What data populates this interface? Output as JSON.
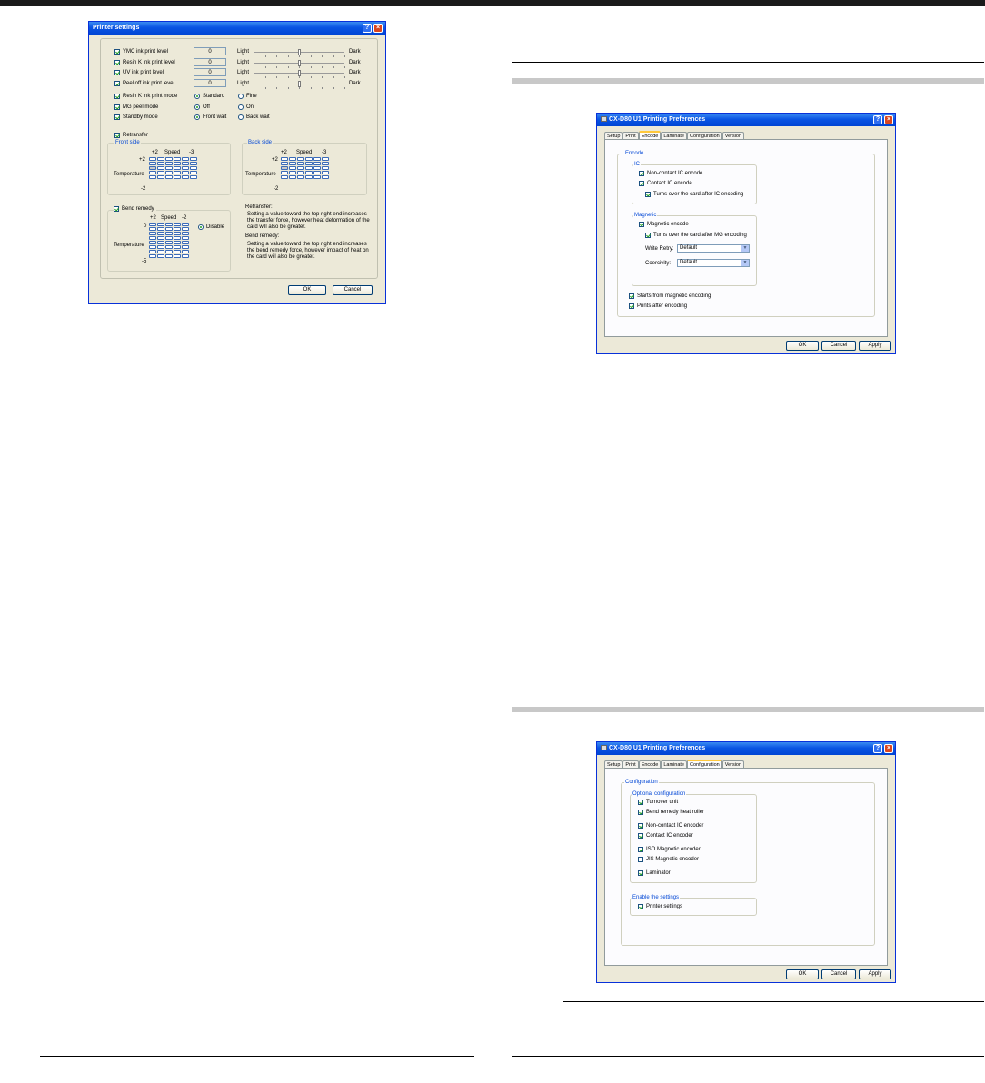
{
  "printer_settings": {
    "title": "Printer settings",
    "levels": [
      {
        "label": "YMC ink print level",
        "value": "0",
        "light": "Light",
        "dark": "Dark",
        "level_pct": 50
      },
      {
        "label": "Resin K ink print level",
        "value": "0",
        "light": "Light",
        "dark": "Dark",
        "level_pct": 50
      },
      {
        "label": "UV ink print level",
        "value": "0",
        "light": "Light",
        "dark": "Dark",
        "level_pct": 50
      },
      {
        "label": "Peel off ink print level",
        "value": "0",
        "light": "Light",
        "dark": "Dark",
        "level_pct": 50
      }
    ],
    "modes": [
      {
        "label": "Resin K ink print mode",
        "opt1": "Standard",
        "opt2": "Fine",
        "selected": 1
      },
      {
        "label": "MG peel mode",
        "opt1": "Off",
        "opt2": "On",
        "selected": 1
      },
      {
        "label": "Standby mode",
        "opt1": "Front wait",
        "opt2": "Back wait",
        "selected": 1
      }
    ],
    "retransfer": "Retransfer",
    "front_side": "Front side",
    "back_side": "Back side",
    "speed": "Speed",
    "temperature": "Temperature",
    "plus2": "+2",
    "minus3": "-3",
    "minus2": "-2",
    "bend_remedy": "Bend remedy",
    "bend_plus2": "+2",
    "bend_minus2": "-2",
    "bend_zero": "0",
    "bend_minus5": "-5",
    "disable": "Disable",
    "retransfer_note_title": "Retransfer:",
    "retransfer_note": "Setting a value toward the top right end increases the transfer force, however heat deformation of the card will also be greater.",
    "bend_note_title": "Bend remedy:",
    "bend_note": "Setting a value toward the top right end increases the bend remedy force, however impact of heat on the card will also be greater.",
    "ok": "OK",
    "cancel": "Cancel"
  },
  "encode_dialog": {
    "title": "CX-D80 U1 Printing Preferences",
    "tabs": [
      "Setup",
      "Print",
      "Encode",
      "Laminate",
      "Configuration",
      "Version"
    ],
    "active_tab": "Encode",
    "encode_group": "Encode",
    "ic_group": "IC",
    "non_contact_ic": "Non-contact IC encode",
    "contact_ic": "Contact IC encode",
    "turn_over_ic": "Turns over the card after IC encoding",
    "magnetic_group": "Magnetic",
    "magnetic_encode": "Magnetic encode",
    "turn_over_mg": "Turns over the card after MG encoding",
    "write_retry_label": "Write Retry:",
    "write_retry_value": "Default",
    "coercivity_label": "Coercivity:",
    "coercivity_value": "Default",
    "starts_from_magnetic": "Starts from magnetic encoding",
    "prints_after_encoding": "Prints after encoding",
    "ok": "OK",
    "cancel": "Cancel",
    "apply": "Apply"
  },
  "config_dialog": {
    "title": "CX-D80 U1 Printing Preferences",
    "tabs": [
      "Setup",
      "Print",
      "Encode",
      "Laminate",
      "Configuration",
      "Version"
    ],
    "active_tab": "Configuration",
    "config_group": "Configuration",
    "optional_group": "Optional configuration",
    "items": [
      {
        "label": "Turnover unit",
        "checked": true
      },
      {
        "label": "Bend remedy heat roller",
        "checked": true
      },
      {
        "label": "Non-contact IC encoder",
        "checked": true
      },
      {
        "label": "Contact IC encoder",
        "checked": true
      },
      {
        "label": "ISO Magnetic encoder",
        "checked": true
      },
      {
        "label": "JIS Magnetic encoder",
        "checked": false
      },
      {
        "label": "Laminator",
        "checked": true
      }
    ],
    "enable_group": "Enable the settings",
    "printer_settings": "Printer settings",
    "ok": "OK",
    "cancel": "Cancel",
    "apply": "Apply"
  }
}
